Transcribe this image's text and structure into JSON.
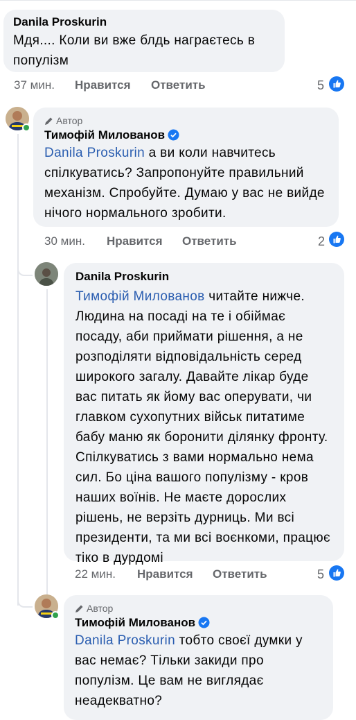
{
  "comments": [
    {
      "author": "Danila Proskurin",
      "text": "Мдя.... Коли ви вже блдь награєтесь в популізм",
      "time": "37 мин.",
      "like_label": "Нравится",
      "reply_label": "Ответить",
      "likes": "5"
    },
    {
      "author": "Тимофій Милованов",
      "badge": "Автор",
      "mention": "Danila Proskurin",
      "text": "а ви коли навчитесь спілкуватись? Запропонуйте правильний механізм. Спробуйте. Думаю у вас не вийде нічого нормального зробити.",
      "time": "30 мин.",
      "like_label": "Нравится",
      "reply_label": "Ответить",
      "likes": "2"
    },
    {
      "author": "Danila Proskurin",
      "mention": "Тимофій Милованов",
      "text": "читайте нижче. Людина на посаді на те і обіймає посаду, аби приймати рішення, а не розподіляти відповідальність серед широкого загалу. Давайте лікар буде вас питать як йому вас оперувати, чи главком сухопутних військ питатиме бабу маню як боронити ділянку фронту. Спілкуватись з вами нормально нема сил. Бо ціна вашого популізму - кров наших воїнів. Не маєте дорослих рішень, не верзіть дурниць. Ми всі президенти, та ми всі воєнкоми, працює тіко в дурдомі",
      "time": "22 мин.",
      "like_label": "Нравится",
      "reply_label": "Ответить",
      "likes": "5"
    },
    {
      "author": "Тимофій Милованов",
      "badge": "Автор",
      "mention": "Danila Proskurin",
      "text": "тобто своєї думки у вас немає? Тільки закиди про популізм. Це вам не виглядає неадекватно?"
    }
  ],
  "colors": {
    "bubble": "#f0f2f5",
    "mention": "#2a5db0",
    "meta": "#65676b",
    "like": "#1877f2"
  },
  "icons": {
    "verified": "verified-badge-icon",
    "pencil": "pencil-icon",
    "like": "like-thumb-icon"
  }
}
